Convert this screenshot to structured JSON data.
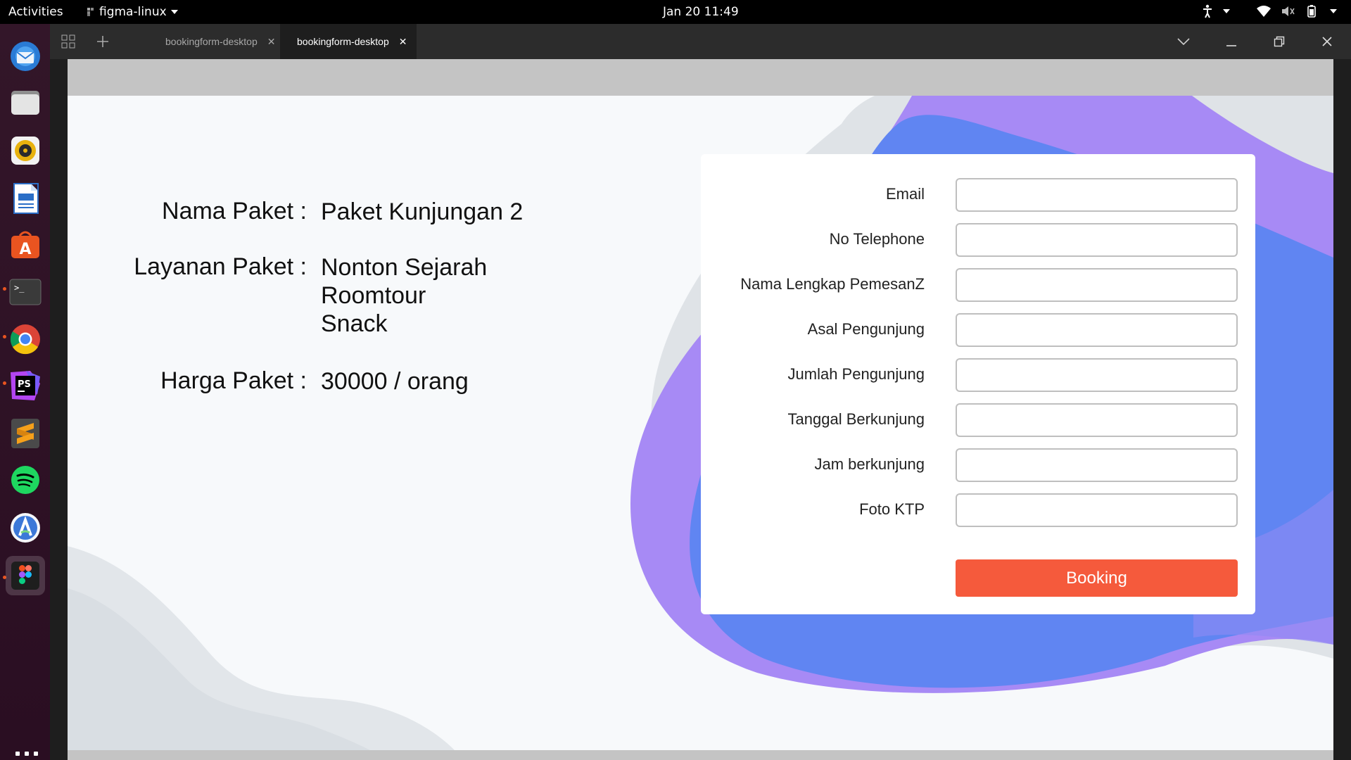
{
  "topbar": {
    "activities": "Activities",
    "app_name": "figma-linux",
    "clock": "Jan 20  11:49"
  },
  "dock": {
    "items": [
      {
        "name": "thunderbird-icon",
        "running": false,
        "active": false
      },
      {
        "name": "files-icon",
        "running": false,
        "active": false
      },
      {
        "name": "rhythmbox-icon",
        "running": false,
        "active": false
      },
      {
        "name": "writer-icon",
        "running": false,
        "active": false
      },
      {
        "name": "app-center-icon",
        "running": false,
        "active": false
      },
      {
        "name": "terminal-icon",
        "running": true,
        "active": false
      },
      {
        "name": "chrome-icon",
        "running": true,
        "active": false
      },
      {
        "name": "phpstorm-icon",
        "running": true,
        "active": false
      },
      {
        "name": "sublime-icon",
        "running": false,
        "active": false
      },
      {
        "name": "spotify-icon",
        "running": false,
        "active": false
      },
      {
        "name": "android-studio-icon",
        "running": false,
        "active": false
      },
      {
        "name": "figma-icon",
        "running": true,
        "active": true
      }
    ]
  },
  "figma": {
    "tabs": [
      {
        "label": "bookingform-desktop",
        "active": false
      },
      {
        "label": "bookingform-desktop",
        "active": true
      }
    ]
  },
  "package": {
    "name_label": "Nama Paket :",
    "name_value": "Paket Kunjungan 2",
    "services_label": "Layanan Paket :",
    "services": [
      "Nonton Sejarah",
      "Roomtour",
      "Snack"
    ],
    "price_label": "Harga Paket :",
    "price_value": "30000 / orang"
  },
  "form": {
    "fields": [
      {
        "label": "Email",
        "value": ""
      },
      {
        "label": "No Telephone",
        "value": ""
      },
      {
        "label": "Nama Lengkap PemesanZ",
        "value": ""
      },
      {
        "label": "Asal Pengunjung",
        "value": ""
      },
      {
        "label": "Jumlah Pengunjung",
        "value": ""
      },
      {
        "label": "Tanggal Berkunjung",
        "value": ""
      },
      {
        "label": "Jam berkunjung",
        "value": ""
      },
      {
        "label": "Foto KTP",
        "value": ""
      }
    ],
    "submit_label": "Booking"
  },
  "colors": {
    "accent": "#f55a3c",
    "blob_blue": "#5f87f2",
    "blob_purple": "#a78af5"
  }
}
